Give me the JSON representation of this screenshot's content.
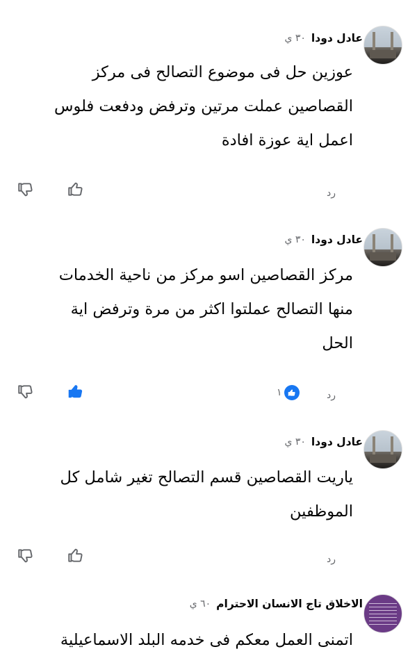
{
  "comments": [
    {
      "author": "عادل دودا",
      "time": "٣٠ ي",
      "lines": [
        "عوزين حل فى موضوع التصالح  فى مركز",
        "القصاصين  عملت مرتين  وترفض ودفعت فلوس",
        "اعمل اية عوزة افادة"
      ],
      "reply_label": "رد",
      "liked": false,
      "reaction_count": ""
    },
    {
      "author": "عادل دودا",
      "time": "٣٠ ي",
      "lines": [
        "مركز القصاصين اسو مركز من ناحية الخدمات",
        "منها التصالح عملتوا اكثر من مرة وترفض اية",
        "الحل"
      ],
      "reply_label": "رد",
      "liked": true,
      "reaction_count": "١"
    },
    {
      "author": "عادل دودا",
      "time": "٣٠ ي",
      "lines": [
        "ياريت القصاصين قسم التصالح تغير شامل كل",
        "الموظفين"
      ],
      "reply_label": "رد",
      "liked": false,
      "reaction_count": ""
    },
    {
      "author": "الاخلاق تاج الانسان الاحترام",
      "time": "٦٠ ي",
      "lines": [
        "اتمنى العمل معكم فى خدمه البلد الاسماعيلية"
      ]
    }
  ],
  "icons": {
    "dislike": "thumbs-down-icon",
    "like": "thumbs-up-icon",
    "like_active_color": "#1877f2",
    "muted_color": "#65676b"
  }
}
